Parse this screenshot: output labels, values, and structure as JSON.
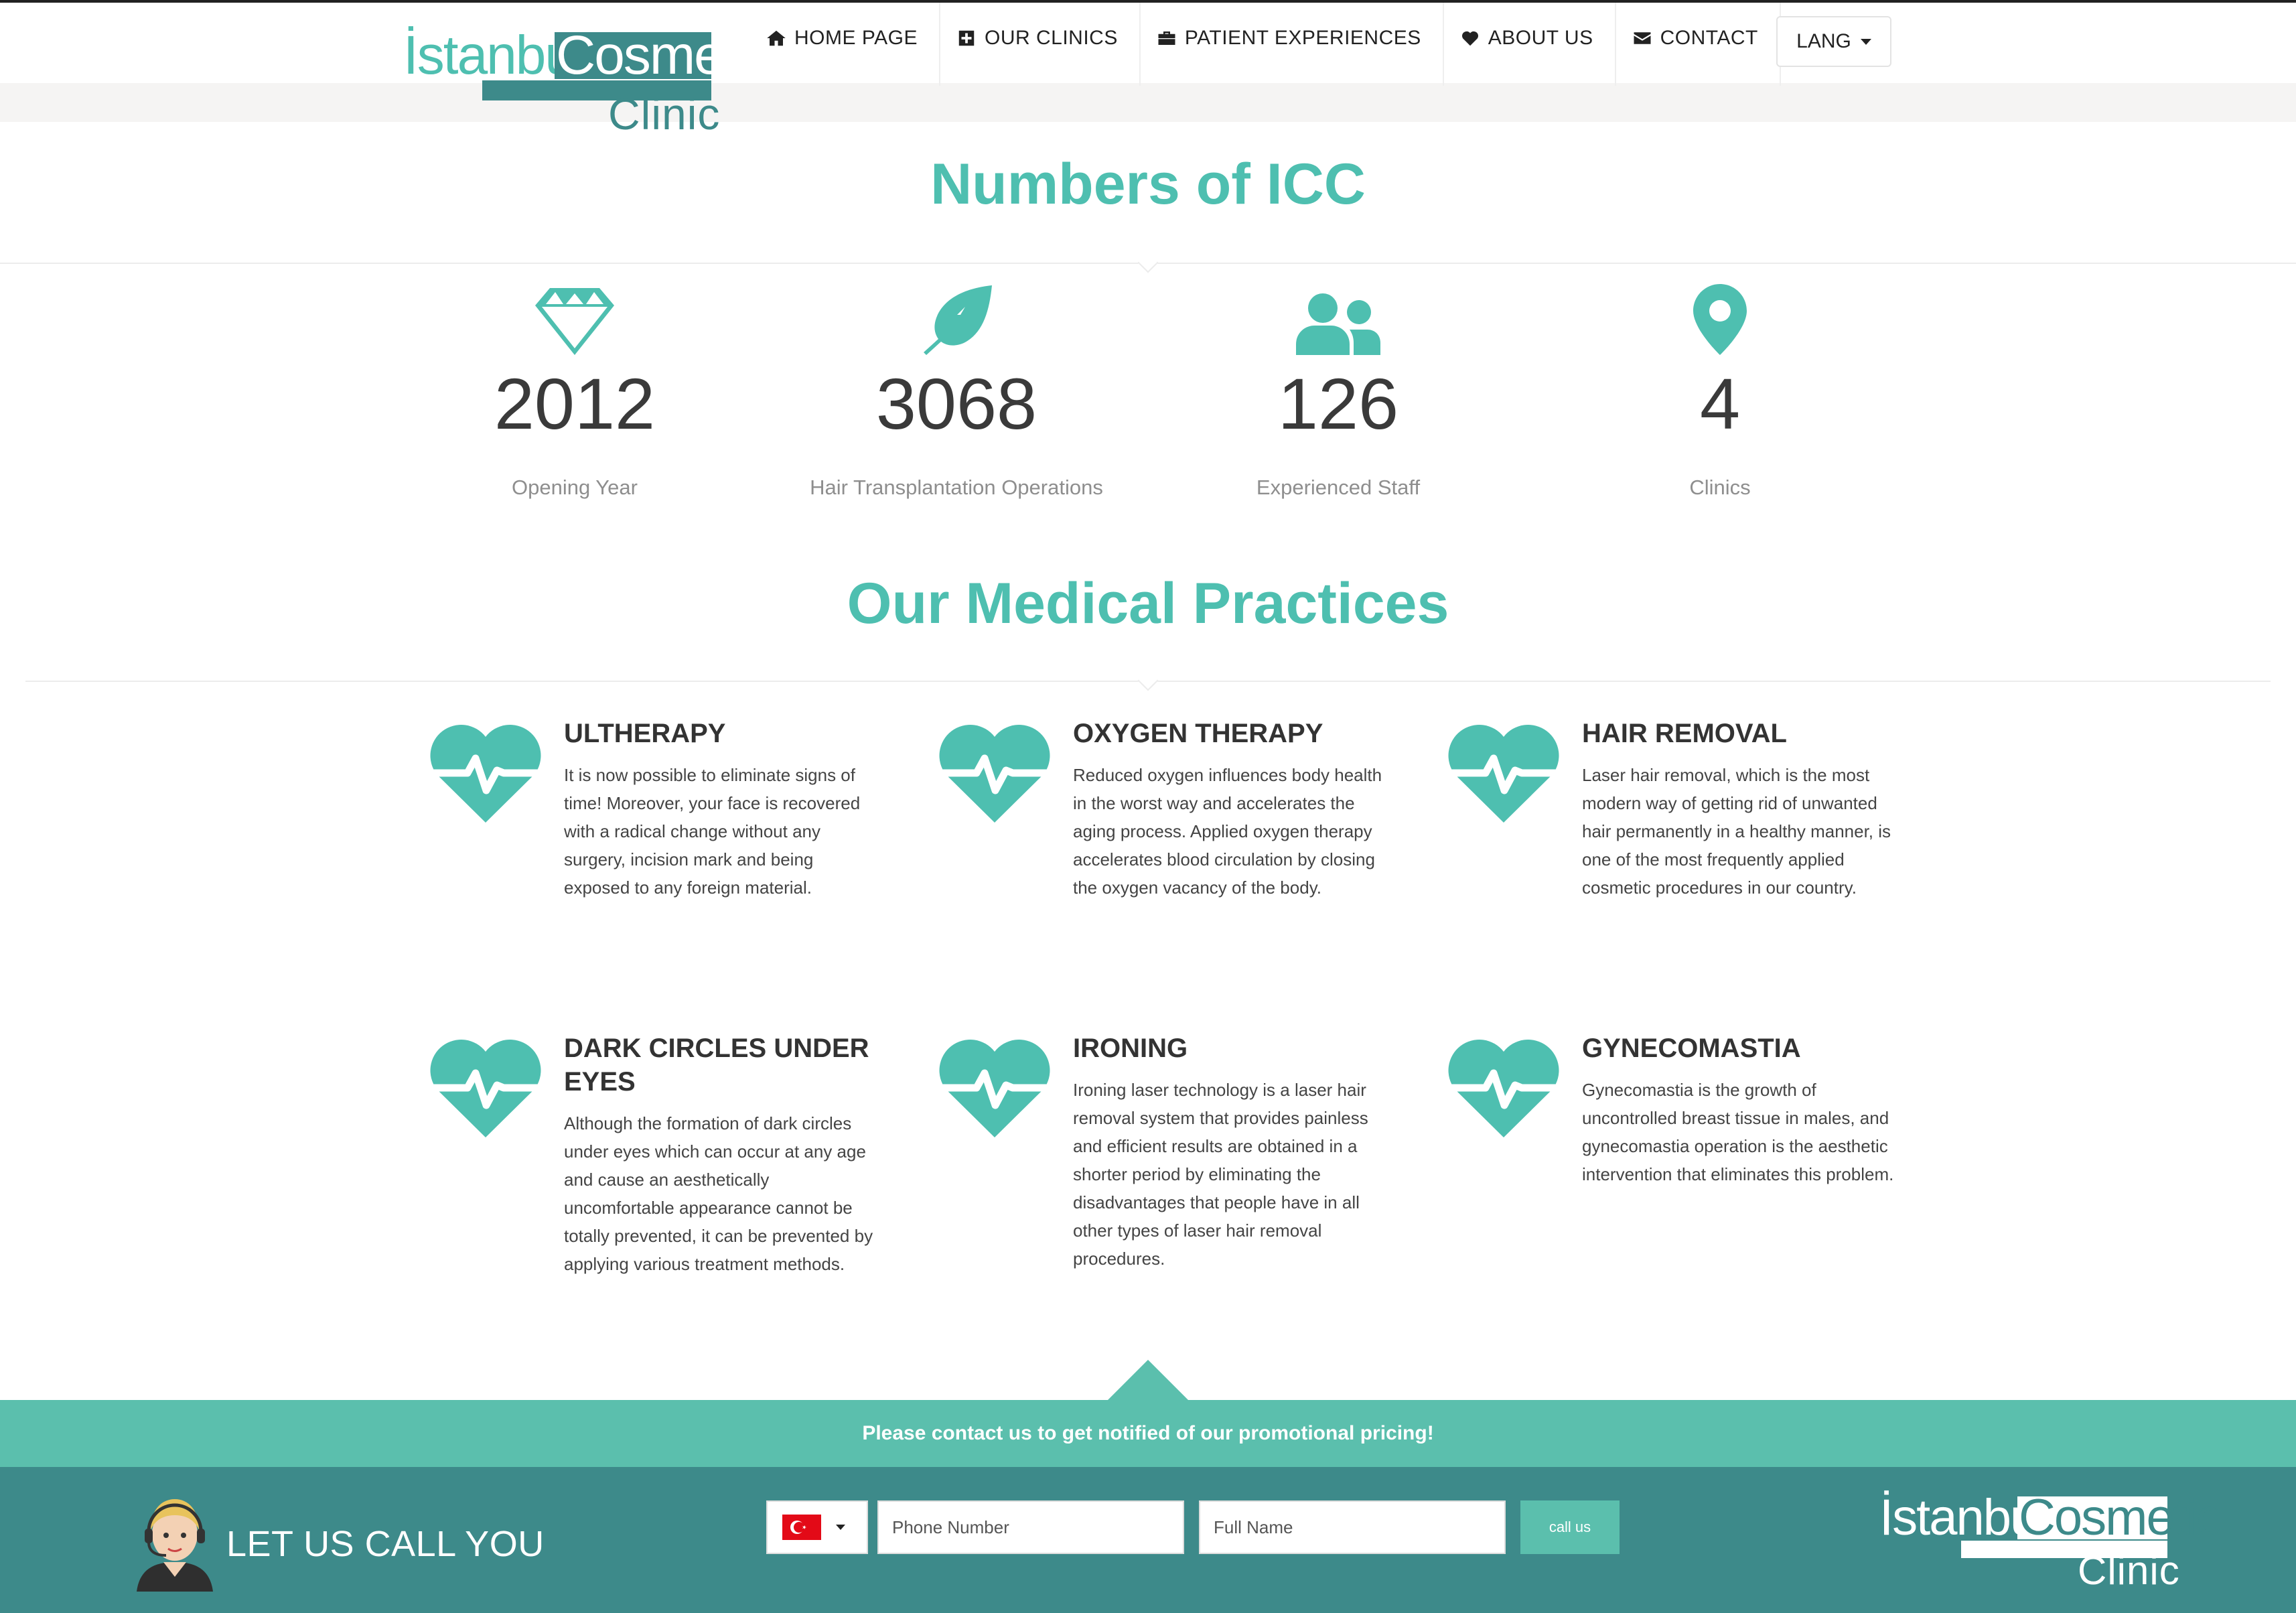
{
  "brand": {
    "istanbul": "İstanbul",
    "cosmetic": "Cosmetic",
    "clinic": "Clinic",
    "color_teal": "#4ebfb0",
    "color_dark_teal": "#3d8a8a"
  },
  "nav": {
    "items": [
      {
        "label": "HOME PAGE",
        "icon": "home-icon"
      },
      {
        "label": "OUR CLINICS",
        "icon": "plus-square-icon"
      },
      {
        "label": "PATIENT EXPERIENCES",
        "icon": "briefcase-icon"
      },
      {
        "label": "ABOUT US",
        "icon": "heart-icon"
      },
      {
        "label": "CONTACT",
        "icon": "envelope-icon"
      }
    ],
    "lang_label": "LANG"
  },
  "stats": {
    "title": "Numbers of ICC",
    "items": [
      {
        "value": "2012",
        "label": "Opening Year",
        "icon": "diamond-icon"
      },
      {
        "value": "3068",
        "label": "Hair Transplantation Operations",
        "icon": "feather-icon"
      },
      {
        "value": "126",
        "label": "Experienced Staff",
        "icon": "users-icon"
      },
      {
        "value": "4",
        "label": "Clinics",
        "icon": "map-marker-icon"
      }
    ]
  },
  "practices": {
    "title": "Our Medical Practices",
    "items": [
      {
        "title": "ULTHERAPY",
        "text": "It is now possible to eliminate signs of time! Moreover, your face is recovered with a radical change without any surgery, incision mark and being exposed to any foreign material.",
        "icon": "heartbeat-icon"
      },
      {
        "title": "OXYGEN THERAPY",
        "text": "Reduced oxygen influences body health in the worst way and accelerates the aging process. Applied oxygen therapy accelerates blood circulation by closing the oxygen vacancy of the body.",
        "icon": "heartbeat-icon"
      },
      {
        "title": "HAIR REMOVAL",
        "text": "Laser hair removal, which is the most modern way of getting rid of unwanted hair permanently in a healthy manner, is one of the most frequently applied cosmetic procedures in our country.",
        "icon": "heartbeat-icon"
      },
      {
        "title": "DARK CIRCLES UNDER EYES",
        "text": "Although the formation of dark circles under eyes which can occur at any age and cause an aesthetically uncomfortable appearance cannot be totally prevented, it can be prevented by applying various treatment methods.",
        "icon": "heartbeat-icon"
      },
      {
        "title": "IRONING",
        "text": "Ironing laser technology is a laser hair removal system that provides painless and efficient results are obtained in a shorter period by eliminating the disadvantages that people have in all other types of laser hair removal procedures.",
        "icon": "heartbeat-icon"
      },
      {
        "title": "GYNECOMASTIA",
        "text": "Gynecomastia is the growth of uncontrolled breast tissue in males, and gynecomastia operation is the aesthetic intervention that eliminates this problem.",
        "icon": "heartbeat-icon"
      }
    ]
  },
  "footer": {
    "promo_text": "Please contact us to get notified of our promotional pricing!",
    "call_title": "LET US CALL YOU",
    "country_flag": "turkey-flag-icon",
    "phone_placeholder": "Phone Number",
    "name_placeholder": "Full Name",
    "call_button": "call us",
    "promo_color": "#5bbfad",
    "call_bg_color": "#3d8a8a"
  }
}
